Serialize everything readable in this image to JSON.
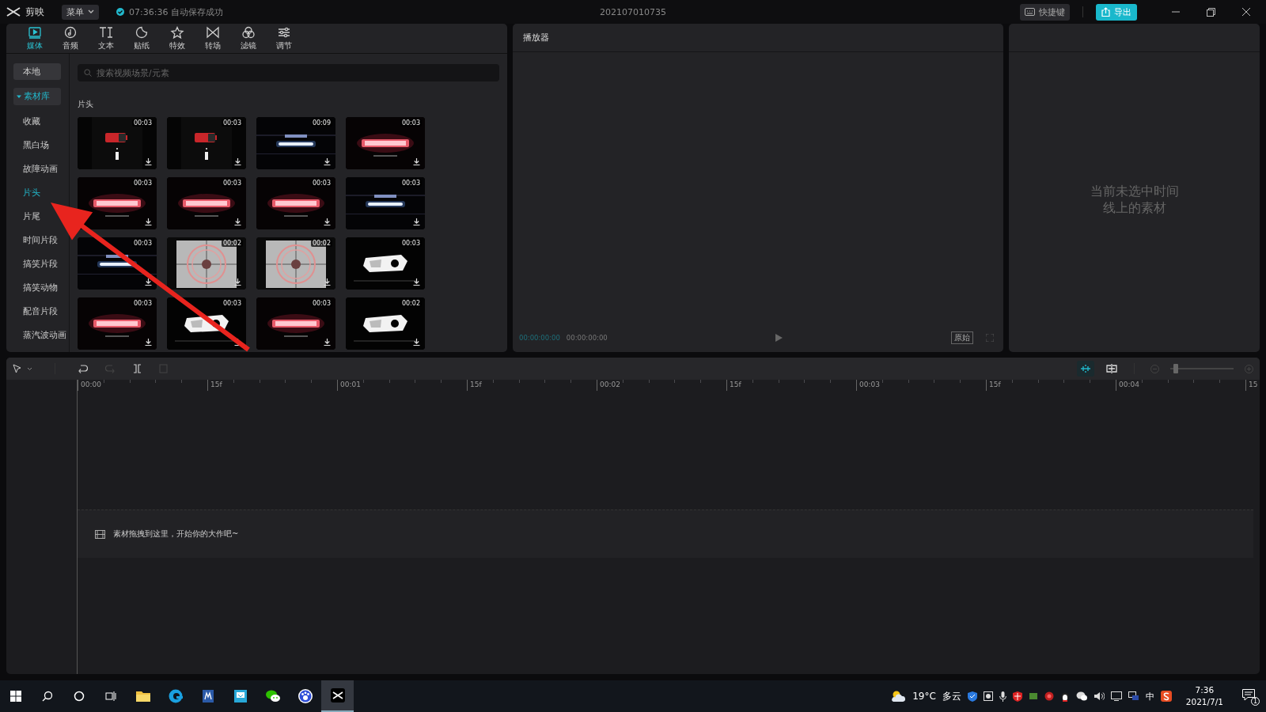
{
  "app": {
    "name": "剪映"
  },
  "menu_button": "菜单",
  "save_status": "07:36:36 自动保存成功",
  "project_title": "202107010735",
  "shortcut_button": "快捷键",
  "export_button": "导出",
  "media_tabs": [
    {
      "label": "媒体",
      "kind": "media",
      "selected": true
    },
    {
      "label": "音频",
      "kind": "audio",
      "selected": false
    },
    {
      "label": "文本",
      "kind": "text",
      "selected": false
    },
    {
      "label": "贴纸",
      "kind": "sticker",
      "selected": false
    },
    {
      "label": "特效",
      "kind": "effect",
      "selected": false
    },
    {
      "label": "转场",
      "kind": "transition",
      "selected": false
    },
    {
      "label": "滤镜",
      "kind": "filter",
      "selected": false
    },
    {
      "label": "调节",
      "kind": "adjust",
      "selected": false
    }
  ],
  "sidebar": {
    "local_button": "本地",
    "library": {
      "label": "素材库",
      "expanded": true
    },
    "items": [
      {
        "label": "收藏",
        "selected": false
      },
      {
        "label": "黑白场",
        "selected": false
      },
      {
        "label": "故障动画",
        "selected": false
      },
      {
        "label": "片头",
        "selected": true
      },
      {
        "label": "片尾",
        "selected": false
      },
      {
        "label": "时间片段",
        "selected": false
      },
      {
        "label": "搞笑片段",
        "selected": false
      },
      {
        "label": "搞笑动物",
        "selected": false
      },
      {
        "label": "配音片段",
        "selected": false
      },
      {
        "label": "蒸汽波动画",
        "selected": false
      }
    ]
  },
  "search": {
    "placeholder": "搜索视频场景/元素"
  },
  "section_title": "片头",
  "clips": [
    {
      "duration": "00:03",
      "kind": "picture"
    },
    {
      "duration": "00:03",
      "kind": "picture"
    },
    {
      "duration": "00:09",
      "kind": "picture"
    },
    {
      "duration": "00:03",
      "kind": "picture"
    },
    {
      "duration": "00:03",
      "kind": "picture"
    },
    {
      "duration": "00:03",
      "kind": "picture"
    },
    {
      "duration": "00:03",
      "kind": "picture"
    },
    {
      "duration": "00:03",
      "kind": "picture"
    },
    {
      "duration": "00:03",
      "kind": "picture"
    },
    {
      "duration": "00:02",
      "kind": "picture"
    },
    {
      "duration": "00:02",
      "kind": "picture"
    },
    {
      "duration": "00:03",
      "kind": "picture"
    },
    {
      "duration": "00:03",
      "kind": "picture"
    },
    {
      "duration": "00:03",
      "kind": "picture"
    },
    {
      "duration": "00:03",
      "kind": "picture"
    },
    {
      "duration": "00:02",
      "kind": "picture"
    }
  ],
  "player": {
    "title": "播放器",
    "current_time": "00:00:00:00",
    "total_time": "00:00:00:00",
    "ratio_button": "原始"
  },
  "details": {
    "empty_message": "当前未选中时间线上的素材"
  },
  "timeline": {
    "snap_on": true,
    "zoom": {
      "level": 0.05
    },
    "ruler": [
      "00:00",
      "15f",
      "00:01",
      "15f",
      "00:02",
      "15f",
      "00:03",
      "15f",
      "00:04",
      "15"
    ],
    "drop_hint": "素材拖拽到这里，开始你的大作吧~"
  },
  "taskbar": {
    "apps": [
      {
        "kind": "folder",
        "active": false
      },
      {
        "kind": "browser",
        "active": false
      },
      {
        "kind": "docs",
        "active": false
      },
      {
        "kind": "screen",
        "active": false
      },
      {
        "kind": "chat",
        "active": false
      },
      {
        "kind": "paw",
        "active": false
      },
      {
        "kind": "editor",
        "active": true
      }
    ],
    "weather": {
      "temperature": "19°C",
      "condition": "多云"
    },
    "ime": "中",
    "clock": {
      "time": "7:36",
      "date": "2021/7/1"
    },
    "notifications": "1"
  }
}
